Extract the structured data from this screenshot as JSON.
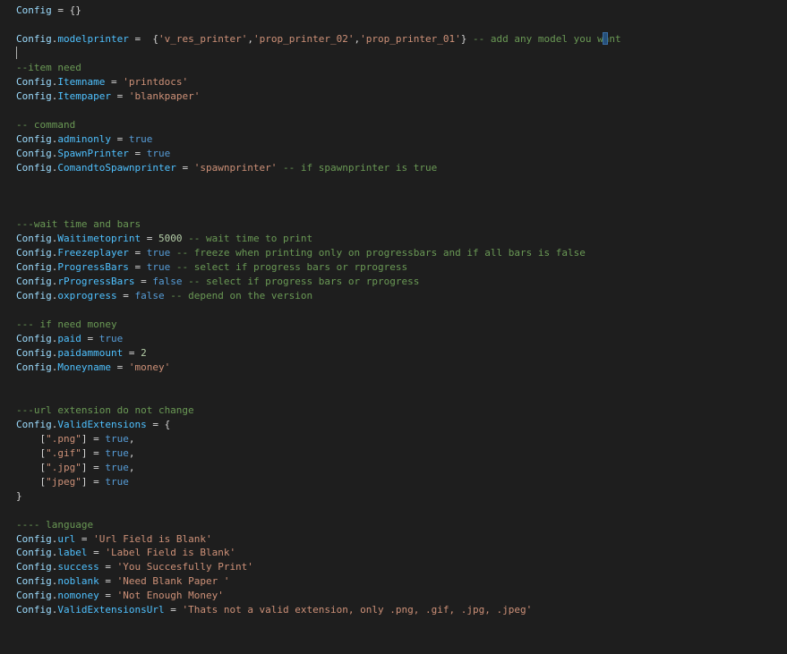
{
  "editor": {
    "lines": [
      {
        "tokens": [
          {
            "t": "Config",
            "c": "obj"
          },
          {
            "t": " = {}",
            "c": "punct"
          }
        ]
      },
      {
        "tokens": []
      },
      {
        "tokens": [
          {
            "t": "Config",
            "c": "obj"
          },
          {
            "t": ".",
            "c": "punct"
          },
          {
            "t": "modelprinter",
            "c": "prop"
          },
          {
            "t": " =  {",
            "c": "op"
          },
          {
            "t": "'v_res_printer'",
            "c": "str"
          },
          {
            "t": ",",
            "c": "punct"
          },
          {
            "t": "'prop_printer_02'",
            "c": "str"
          },
          {
            "t": ",",
            "c": "punct"
          },
          {
            "t": "'prop_printer_01'",
            "c": "str"
          },
          {
            "t": "} ",
            "c": "punct"
          },
          {
            "t": "-- add any model you want",
            "c": "com"
          }
        ]
      },
      {
        "tokens": []
      },
      {
        "tokens": [
          {
            "t": "--item need",
            "c": "com"
          }
        ]
      },
      {
        "tokens": [
          {
            "t": "Config",
            "c": "obj"
          },
          {
            "t": ".",
            "c": "punct"
          },
          {
            "t": "Itemname",
            "c": "prop"
          },
          {
            "t": " = ",
            "c": "op"
          },
          {
            "t": "'printdocs'",
            "c": "str"
          }
        ]
      },
      {
        "tokens": [
          {
            "t": "Config",
            "c": "obj"
          },
          {
            "t": ".",
            "c": "punct"
          },
          {
            "t": "Itempaper",
            "c": "prop"
          },
          {
            "t": " = ",
            "c": "op"
          },
          {
            "t": "'blankpaper'",
            "c": "str"
          }
        ]
      },
      {
        "tokens": []
      },
      {
        "tokens": [
          {
            "t": "-- command",
            "c": "com"
          }
        ]
      },
      {
        "tokens": [
          {
            "t": "Config",
            "c": "obj"
          },
          {
            "t": ".",
            "c": "punct"
          },
          {
            "t": "adminonly",
            "c": "prop"
          },
          {
            "t": " = ",
            "c": "op"
          },
          {
            "t": "true",
            "c": "kw"
          }
        ]
      },
      {
        "tokens": [
          {
            "t": "Config",
            "c": "obj"
          },
          {
            "t": ".",
            "c": "punct"
          },
          {
            "t": "SpawnPrinter",
            "c": "prop"
          },
          {
            "t": " = ",
            "c": "op"
          },
          {
            "t": "true",
            "c": "kw"
          }
        ]
      },
      {
        "tokens": [
          {
            "t": "Config",
            "c": "obj"
          },
          {
            "t": ".",
            "c": "punct"
          },
          {
            "t": "ComandtoSpawnprinter",
            "c": "prop"
          },
          {
            "t": " = ",
            "c": "op"
          },
          {
            "t": "'spawnprinter'",
            "c": "str"
          },
          {
            "t": " ",
            "c": "punct"
          },
          {
            "t": "-- if spawnprinter is true",
            "c": "com"
          }
        ]
      },
      {
        "tokens": []
      },
      {
        "tokens": []
      },
      {
        "tokens": []
      },
      {
        "tokens": [
          {
            "t": "---wait time and bars",
            "c": "com"
          }
        ]
      },
      {
        "tokens": [
          {
            "t": "Config",
            "c": "obj"
          },
          {
            "t": ".",
            "c": "punct"
          },
          {
            "t": "Waitimetoprint",
            "c": "prop"
          },
          {
            "t": " = ",
            "c": "op"
          },
          {
            "t": "5000",
            "c": "num"
          },
          {
            "t": " ",
            "c": "punct"
          },
          {
            "t": "-- wait time to print",
            "c": "com"
          }
        ]
      },
      {
        "tokens": [
          {
            "t": "Config",
            "c": "obj"
          },
          {
            "t": ".",
            "c": "punct"
          },
          {
            "t": "Freezeplayer",
            "c": "prop"
          },
          {
            "t": " = ",
            "c": "op"
          },
          {
            "t": "true",
            "c": "kw"
          },
          {
            "t": " ",
            "c": "punct"
          },
          {
            "t": "-- freeze when printing only on progressbars and if all bars is false",
            "c": "com"
          }
        ]
      },
      {
        "tokens": [
          {
            "t": "Config",
            "c": "obj"
          },
          {
            "t": ".",
            "c": "punct"
          },
          {
            "t": "ProgressBars",
            "c": "prop"
          },
          {
            "t": " = ",
            "c": "op"
          },
          {
            "t": "true",
            "c": "kw"
          },
          {
            "t": " ",
            "c": "punct"
          },
          {
            "t": "-- select if progress bars or rprogress",
            "c": "com"
          }
        ]
      },
      {
        "tokens": [
          {
            "t": "Config",
            "c": "obj"
          },
          {
            "t": ".",
            "c": "punct"
          },
          {
            "t": "rProgressBars",
            "c": "prop"
          },
          {
            "t": " = ",
            "c": "op"
          },
          {
            "t": "false",
            "c": "kw"
          },
          {
            "t": " ",
            "c": "punct"
          },
          {
            "t": "-- select if progress bars or rprogress",
            "c": "com"
          }
        ]
      },
      {
        "tokens": [
          {
            "t": "Config",
            "c": "obj"
          },
          {
            "t": ".",
            "c": "punct"
          },
          {
            "t": "oxprogress",
            "c": "prop"
          },
          {
            "t": " = ",
            "c": "op"
          },
          {
            "t": "false",
            "c": "kw"
          },
          {
            "t": " ",
            "c": "punct"
          },
          {
            "t": "-- depend on the version",
            "c": "com"
          }
        ]
      },
      {
        "tokens": []
      },
      {
        "tokens": [
          {
            "t": "--- if need money",
            "c": "com"
          }
        ]
      },
      {
        "tokens": [
          {
            "t": "Config",
            "c": "obj"
          },
          {
            "t": ".",
            "c": "punct"
          },
          {
            "t": "paid",
            "c": "prop"
          },
          {
            "t": " = ",
            "c": "op"
          },
          {
            "t": "true",
            "c": "kw"
          }
        ]
      },
      {
        "tokens": [
          {
            "t": "Config",
            "c": "obj"
          },
          {
            "t": ".",
            "c": "punct"
          },
          {
            "t": "paidammount",
            "c": "prop"
          },
          {
            "t": " = ",
            "c": "op"
          },
          {
            "t": "2",
            "c": "num"
          }
        ]
      },
      {
        "tokens": [
          {
            "t": "Config",
            "c": "obj"
          },
          {
            "t": ".",
            "c": "punct"
          },
          {
            "t": "Moneyname",
            "c": "prop"
          },
          {
            "t": " = ",
            "c": "op"
          },
          {
            "t": "'money'",
            "c": "str"
          }
        ]
      },
      {
        "tokens": []
      },
      {
        "tokens": []
      },
      {
        "tokens": [
          {
            "t": "---url extension do not change",
            "c": "com"
          }
        ]
      },
      {
        "tokens": [
          {
            "t": "Config",
            "c": "obj"
          },
          {
            "t": ".",
            "c": "punct"
          },
          {
            "t": "ValidExtensions",
            "c": "prop"
          },
          {
            "t": " = {",
            "c": "op"
          }
        ]
      },
      {
        "tokens": [
          {
            "t": "    [",
            "c": "punct"
          },
          {
            "t": "\".png\"",
            "c": "str"
          },
          {
            "t": "] = ",
            "c": "punct"
          },
          {
            "t": "true",
            "c": "kw"
          },
          {
            "t": ",",
            "c": "punct"
          }
        ]
      },
      {
        "tokens": [
          {
            "t": "    [",
            "c": "punct"
          },
          {
            "t": "\".gif\"",
            "c": "str"
          },
          {
            "t": "] = ",
            "c": "punct"
          },
          {
            "t": "true",
            "c": "kw"
          },
          {
            "t": ",",
            "c": "punct"
          }
        ]
      },
      {
        "tokens": [
          {
            "t": "    [",
            "c": "punct"
          },
          {
            "t": "\".jpg\"",
            "c": "str"
          },
          {
            "t": "] = ",
            "c": "punct"
          },
          {
            "t": "true",
            "c": "kw"
          },
          {
            "t": ",",
            "c": "punct"
          }
        ]
      },
      {
        "tokens": [
          {
            "t": "    [",
            "c": "punct"
          },
          {
            "t": "\"jpeg\"",
            "c": "str"
          },
          {
            "t": "] = ",
            "c": "punct"
          },
          {
            "t": "true",
            "c": "kw"
          }
        ]
      },
      {
        "tokens": [
          {
            "t": "}",
            "c": "punct"
          }
        ]
      },
      {
        "tokens": []
      },
      {
        "tokens": [
          {
            "t": "---- language",
            "c": "com"
          }
        ]
      },
      {
        "tokens": [
          {
            "t": "Config",
            "c": "obj"
          },
          {
            "t": ".",
            "c": "punct"
          },
          {
            "t": "url",
            "c": "prop"
          },
          {
            "t": " = ",
            "c": "op"
          },
          {
            "t": "'Url Field is Blank'",
            "c": "str"
          }
        ]
      },
      {
        "tokens": [
          {
            "t": "Config",
            "c": "obj"
          },
          {
            "t": ".",
            "c": "punct"
          },
          {
            "t": "label",
            "c": "prop"
          },
          {
            "t": " = ",
            "c": "op"
          },
          {
            "t": "'Label Field is Blank'",
            "c": "str"
          }
        ]
      },
      {
        "tokens": [
          {
            "t": "Config",
            "c": "obj"
          },
          {
            "t": ".",
            "c": "punct"
          },
          {
            "t": "success",
            "c": "prop"
          },
          {
            "t": " = ",
            "c": "op"
          },
          {
            "t": "'You Succesfully Print'",
            "c": "str"
          }
        ]
      },
      {
        "tokens": [
          {
            "t": "Config",
            "c": "obj"
          },
          {
            "t": ".",
            "c": "punct"
          },
          {
            "t": "noblank",
            "c": "prop"
          },
          {
            "t": " = ",
            "c": "op"
          },
          {
            "t": "'Need Blank Paper '",
            "c": "str"
          }
        ]
      },
      {
        "tokens": [
          {
            "t": "Config",
            "c": "obj"
          },
          {
            "t": ".",
            "c": "punct"
          },
          {
            "t": "nomoney",
            "c": "prop"
          },
          {
            "t": " = ",
            "c": "op"
          },
          {
            "t": "'Not Enough Money'",
            "c": "str"
          }
        ]
      },
      {
        "tokens": [
          {
            "t": "Config",
            "c": "obj"
          },
          {
            "t": ".",
            "c": "punct"
          },
          {
            "t": "ValidExtensionsUrl",
            "c": "prop"
          },
          {
            "t": " = ",
            "c": "op"
          },
          {
            "t": "'Thats not a valid extension, only .png, .gif, .jpg, .jpeg'",
            "c": "str"
          }
        ]
      }
    ]
  },
  "colors": {
    "background": "#1e1e1e",
    "identifier": "#9cdcfe",
    "property": "#4fc1ff",
    "string": "#ce9178",
    "keyword": "#569cd6",
    "number": "#b5cea8",
    "comment": "#6a9955",
    "punctuation": "#d4d4d4"
  }
}
